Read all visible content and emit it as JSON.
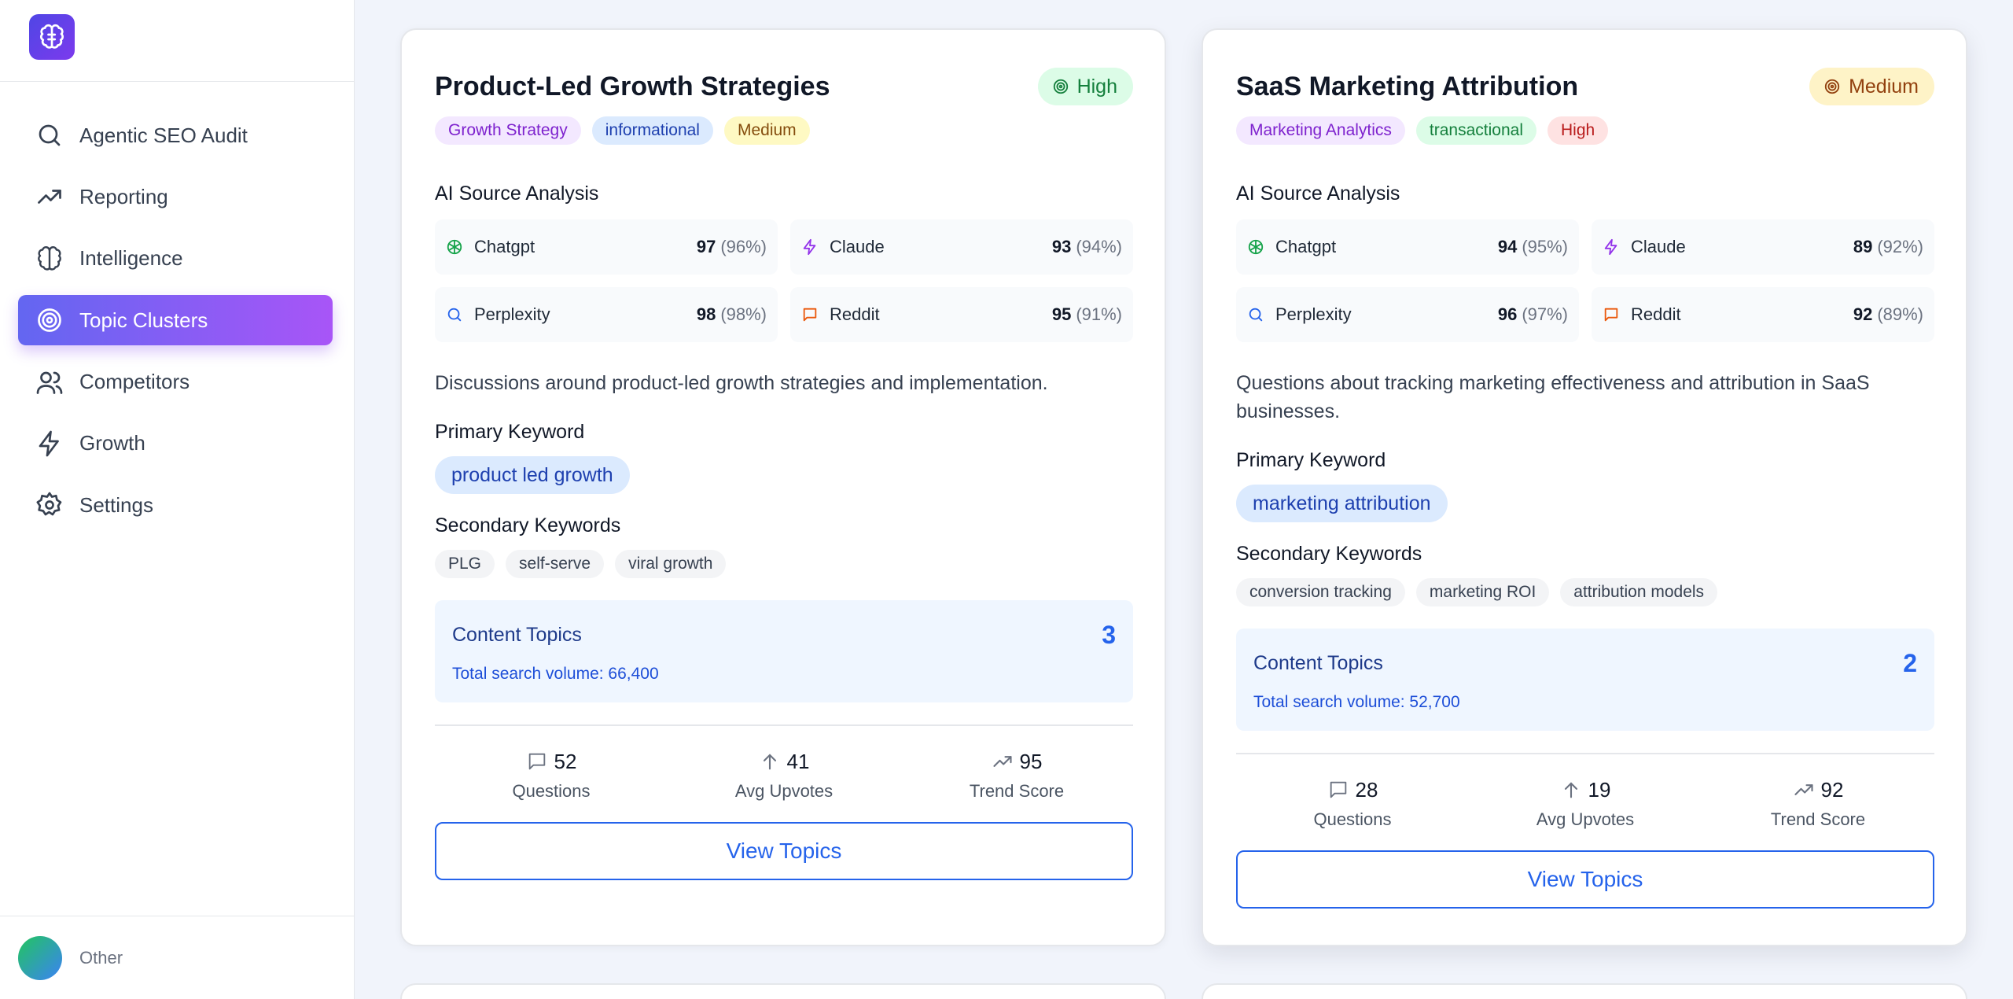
{
  "sidebar": {
    "logo_icon": "brain-icon",
    "items": [
      {
        "label": "Agentic SEO Audit",
        "icon": "search-icon",
        "active": false
      },
      {
        "label": "Reporting",
        "icon": "trend-up-icon",
        "active": false
      },
      {
        "label": "Intelligence",
        "icon": "brain-icon",
        "active": false
      },
      {
        "label": "Topic Clusters",
        "icon": "target-icon",
        "active": true
      },
      {
        "label": "Competitors",
        "icon": "users-icon",
        "active": false
      },
      {
        "label": "Growth",
        "icon": "zap-icon",
        "active": false
      },
      {
        "label": "Settings",
        "icon": "gear-icon",
        "active": false
      }
    ],
    "footer_label": "Other"
  },
  "colors": {
    "accent_start": "#6366f1",
    "accent_end": "#a855f7",
    "primary_blue": "#2563eb",
    "high_green": "#15803d",
    "medium_amber": "#92400e"
  },
  "cards": [
    {
      "title": "Product-Led Growth Strategies",
      "priority": "High",
      "tags": [
        {
          "label": "Growth Strategy",
          "color": "purple"
        },
        {
          "label": "informational",
          "color": "blue"
        },
        {
          "label": "Medium",
          "color": "yellow"
        }
      ],
      "ai_label": "AI Source Analysis",
      "ai_sources": [
        {
          "name": "Chatgpt",
          "score": "97",
          "pct": "(96%)",
          "icon": "chatgpt-icon"
        },
        {
          "name": "Claude",
          "score": "93",
          "pct": "(94%)",
          "icon": "zap-icon"
        },
        {
          "name": "Perplexity",
          "score": "98",
          "pct": "(98%)",
          "icon": "search-icon"
        },
        {
          "name": "Reddit",
          "score": "95",
          "pct": "(91%)",
          "icon": "message-icon"
        }
      ],
      "description": "Discussions around product-led growth strategies and implementation.",
      "primary_keyword_label": "Primary Keyword",
      "primary_keyword": "product led growth",
      "secondary_keywords_label": "Secondary Keywords",
      "secondary_keywords": [
        "PLG",
        "self-serve",
        "viral growth"
      ],
      "content_topics_label": "Content Topics",
      "content_topics_count": "3",
      "search_volume": "Total search volume: 66,400",
      "stats": [
        {
          "value": "52",
          "label": "Questions",
          "icon": "message-icon"
        },
        {
          "value": "41",
          "label": "Avg Upvotes",
          "icon": "arrow-up-icon"
        },
        {
          "value": "95",
          "label": "Trend Score",
          "icon": "trend-up-icon"
        }
      ],
      "view_button": "View Topics"
    },
    {
      "title": "SaaS Marketing Attribution",
      "priority": "Medium",
      "tags": [
        {
          "label": "Marketing Analytics",
          "color": "purple"
        },
        {
          "label": "transactional",
          "color": "green"
        },
        {
          "label": "High",
          "color": "red"
        }
      ],
      "ai_label": "AI Source Analysis",
      "ai_sources": [
        {
          "name": "Chatgpt",
          "score": "94",
          "pct": "(95%)",
          "icon": "chatgpt-icon"
        },
        {
          "name": "Claude",
          "score": "89",
          "pct": "(92%)",
          "icon": "zap-icon"
        },
        {
          "name": "Perplexity",
          "score": "96",
          "pct": "(97%)",
          "icon": "search-icon"
        },
        {
          "name": "Reddit",
          "score": "92",
          "pct": "(89%)",
          "icon": "message-icon"
        }
      ],
      "description": "Questions about tracking marketing effectiveness and attribution in SaaS businesses.",
      "primary_keyword_label": "Primary Keyword",
      "primary_keyword": "marketing attribution",
      "secondary_keywords_label": "Secondary Keywords",
      "secondary_keywords": [
        "conversion tracking",
        "marketing ROI",
        "attribution models"
      ],
      "content_topics_label": "Content Topics",
      "content_topics_count": "2",
      "search_volume": "Total search volume: 52,700",
      "stats": [
        {
          "value": "28",
          "label": "Questions",
          "icon": "message-icon"
        },
        {
          "value": "19",
          "label": "Avg Upvotes",
          "icon": "arrow-up-icon"
        },
        {
          "value": "92",
          "label": "Trend Score",
          "icon": "trend-up-icon"
        }
      ],
      "view_button": "View Topics"
    }
  ]
}
